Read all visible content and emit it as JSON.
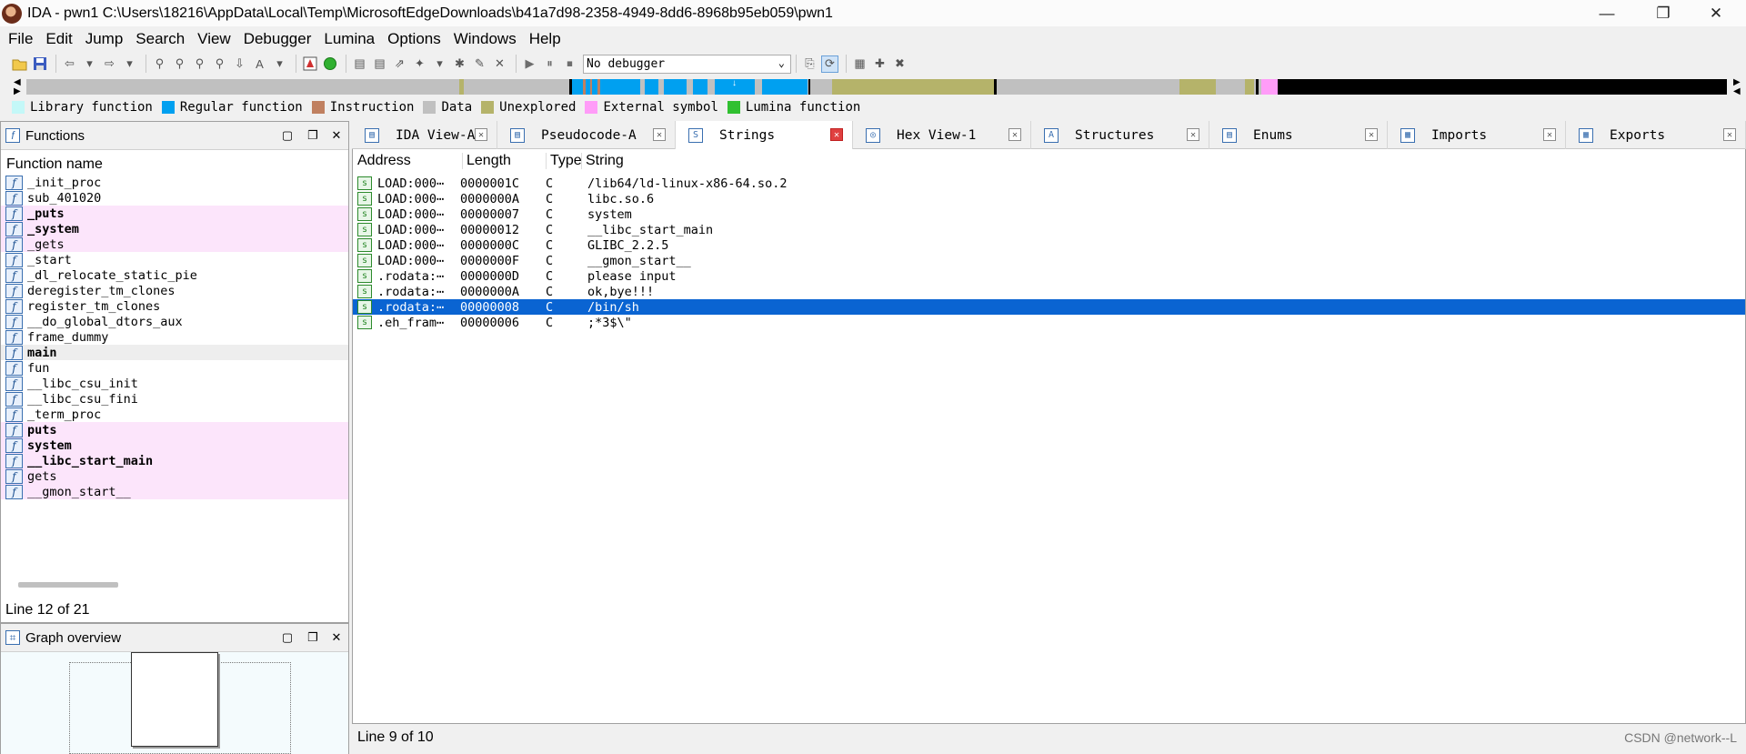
{
  "window": {
    "title": "IDA - pwn1 C:\\Users\\18216\\AppData\\Local\\Temp\\MicrosoftEdgeDownloads\\b41a7d98-2358-4949-8dd6-8968b95eb059\\pwn1",
    "minimize": "—",
    "restore": "❐",
    "close": "✕"
  },
  "menu": [
    "File",
    "Edit",
    "Jump",
    "Search",
    "View",
    "Debugger",
    "Lumina",
    "Options",
    "Windows",
    "Help"
  ],
  "toolbar": {
    "debugger_select": "No debugger",
    "icons": [
      "open-icon",
      "save-icon",
      "back-icon",
      "forward-icon",
      "run-icon",
      "pause-icon",
      "stop-icon"
    ]
  },
  "legend": [
    {
      "label": "Library function",
      "color": "#c4f8f8"
    },
    {
      "label": "Regular function",
      "color": "#00a0f0"
    },
    {
      "label": "Instruction",
      "color": "#c08060"
    },
    {
      "label": "Data",
      "color": "#c0c0c0"
    },
    {
      "label": "Unexplored",
      "color": "#b5b36a"
    },
    {
      "label": "External symbol",
      "color": "#ff9cf8"
    },
    {
      "label": "Lumina function",
      "color": "#30c030"
    }
  ],
  "functions": {
    "title": "Functions",
    "column": "Function name",
    "items": [
      {
        "name": "_init_proc",
        "ext": false,
        "bold": false
      },
      {
        "name": "sub_401020",
        "ext": false,
        "bold": false
      },
      {
        "name": "_puts",
        "ext": true,
        "bold": true
      },
      {
        "name": "_system",
        "ext": true,
        "bold": true
      },
      {
        "name": "_gets",
        "ext": true,
        "bold": false
      },
      {
        "name": "_start",
        "ext": false,
        "bold": false
      },
      {
        "name": "_dl_relocate_static_pie",
        "ext": false,
        "bold": false
      },
      {
        "name": "deregister_tm_clones",
        "ext": false,
        "bold": false
      },
      {
        "name": "register_tm_clones",
        "ext": false,
        "bold": false
      },
      {
        "name": "__do_global_dtors_aux",
        "ext": false,
        "bold": false
      },
      {
        "name": "frame_dummy",
        "ext": false,
        "bold": false
      },
      {
        "name": "main",
        "ext": false,
        "bold": true,
        "current": true
      },
      {
        "name": "fun",
        "ext": false,
        "bold": false
      },
      {
        "name": "__libc_csu_init",
        "ext": false,
        "bold": false
      },
      {
        "name": "__libc_csu_fini",
        "ext": false,
        "bold": false
      },
      {
        "name": "_term_proc",
        "ext": false,
        "bold": false
      },
      {
        "name": "puts",
        "ext": true,
        "bold": true
      },
      {
        "name": "system",
        "ext": true,
        "bold": true
      },
      {
        "name": "__libc_start_main",
        "ext": true,
        "bold": true
      },
      {
        "name": "gets",
        "ext": true,
        "bold": false
      },
      {
        "name": "__gmon_start__",
        "ext": true,
        "bold": false
      }
    ],
    "status": "Line 12 of 21"
  },
  "graph_overview": {
    "title": "Graph overview"
  },
  "tabs": [
    {
      "label": "IDA View-A",
      "icon": "ida-view-icon"
    },
    {
      "label": "Pseudocode-A",
      "icon": "pseudocode-icon"
    },
    {
      "label": "Strings",
      "icon": "strings-icon",
      "active": true
    },
    {
      "label": "Hex View-1",
      "icon": "hex-view-icon"
    },
    {
      "label": "Structures",
      "icon": "structures-icon"
    },
    {
      "label": "Enums",
      "icon": "enums-icon"
    },
    {
      "label": "Imports",
      "icon": "imports-icon"
    },
    {
      "label": "Exports",
      "icon": "exports-icon"
    }
  ],
  "strings": {
    "columns": [
      "Address",
      "Length",
      "Type",
      "String"
    ],
    "rows": [
      {
        "address": "LOAD:000⋯",
        "length": "0000001C",
        "type": "C",
        "string": "/lib64/ld-linux-x86-64.so.2"
      },
      {
        "address": "LOAD:000⋯",
        "length": "0000000A",
        "type": "C",
        "string": "libc.so.6"
      },
      {
        "address": "LOAD:000⋯",
        "length": "00000007",
        "type": "C",
        "string": "system"
      },
      {
        "address": "LOAD:000⋯",
        "length": "00000012",
        "type": "C",
        "string": "__libc_start_main"
      },
      {
        "address": "LOAD:000⋯",
        "length": "0000000C",
        "type": "C",
        "string": "GLIBC_2.2.5"
      },
      {
        "address": "LOAD:000⋯",
        "length": "0000000F",
        "type": "C",
        "string": "__gmon_start__"
      },
      {
        "address": ".rodata:⋯",
        "length": "0000000D",
        "type": "C",
        "string": "please input"
      },
      {
        "address": ".rodata:⋯",
        "length": "0000000A",
        "type": "C",
        "string": "ok,bye!!!"
      },
      {
        "address": ".rodata:⋯",
        "length": "00000008",
        "type": "C",
        "string": "/bin/sh",
        "selected": true
      },
      {
        "address": ".eh_fram⋯",
        "length": "00000006",
        "type": "C",
        "string": ";*3$\\\""
      }
    ],
    "status": "Line 9 of 10"
  },
  "watermark": "CSDN @network--L"
}
